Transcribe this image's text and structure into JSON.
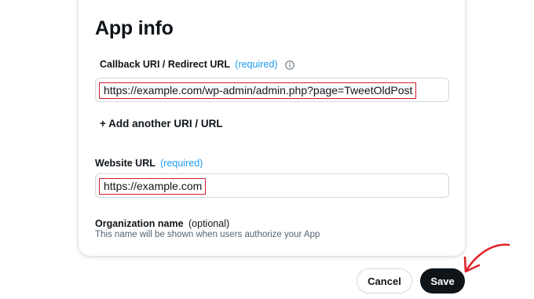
{
  "card": {
    "title": "App info"
  },
  "callback": {
    "label": "Callback URI / Redirect URL",
    "required": "(required)",
    "value": "https://example.com/wp-admin/admin.php?page=TweetOldPost"
  },
  "add_uri": {
    "label": "+ Add another URI / URL"
  },
  "website": {
    "label": "Website URL",
    "required": "(required)",
    "value": "https://example.com"
  },
  "organization": {
    "label": "Organization name",
    "optional": "(optional)",
    "helper": "This name will be shown when users authorize your App"
  },
  "actions": {
    "cancel_label": "Cancel",
    "save_label": "Save"
  },
  "colors": {
    "accent": "#1d9bf0",
    "highlight_border": "#d01e2b",
    "annotation_arrow": "#e0262b",
    "primary_button": "#0f1419"
  },
  "icons": {
    "info": "info-icon",
    "annotation": "annotation-arrow-icon"
  }
}
